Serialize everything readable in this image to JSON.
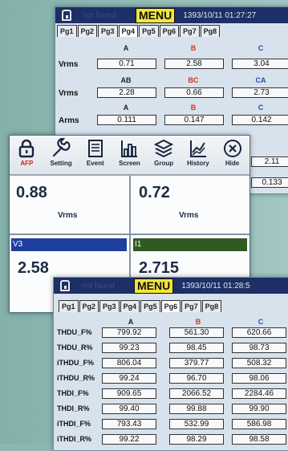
{
  "top_screen": {
    "status_text": "not found",
    "menu_label": "MENU",
    "datetime": "1393/10/11 01:27:27",
    "tabs": [
      "Pg1",
      "Pg2",
      "Pg3",
      "Pg4",
      "Pg5",
      "Pg6",
      "Pg7",
      "Pg8"
    ],
    "active_tab": "Pg4",
    "rows": [
      {
        "label": "Vrms",
        "heads": [
          "A",
          "B",
          "C"
        ],
        "values": [
          "0.71",
          "2.58",
          "3.04"
        ]
      },
      {
        "label": "Vrms",
        "heads": [
          "AB",
          "BC",
          "CA"
        ],
        "values": [
          "2.28",
          "0.66",
          "2.73"
        ]
      },
      {
        "label": "Arms",
        "heads": [
          "A",
          "B",
          "C"
        ],
        "values": [
          "0.111",
          "0.147",
          "0.142"
        ]
      }
    ],
    "partial_values": [
      "2.11",
      "0.133"
    ]
  },
  "dashboard": {
    "toolbar": [
      {
        "label": "AFP",
        "icon": "lock-icon"
      },
      {
        "label": "Setting",
        "icon": "wrench-icon"
      },
      {
        "label": "Event",
        "icon": "document-icon"
      },
      {
        "label": "Screen",
        "icon": "bar-chart-icon"
      },
      {
        "label": "Group",
        "icon": "layers-icon"
      },
      {
        "label": "History",
        "icon": "history-chart-icon"
      },
      {
        "label": "Hide",
        "icon": "close-circle-icon"
      }
    ],
    "panels": [
      {
        "value": "0.88",
        "unit": "Vrms"
      },
      {
        "value": "0.72",
        "unit": "Vrms"
      },
      {
        "channel": "V3",
        "value": "2.58"
      },
      {
        "channel": "I1",
        "value": "2.715"
      }
    ],
    "colors": {
      "v3_bar": "#1f3f9e",
      "i1_bar": "#2f5a22"
    }
  },
  "bottom_screen": {
    "status_text": "not found",
    "menu_label": "MENU",
    "datetime": "1393/10/11 01:28:5",
    "tabs": [
      "Pg1",
      "Pg2",
      "Pg3",
      "Pg4",
      "Pg5",
      "Pg6",
      "Pg7",
      "Pg8"
    ],
    "active_tab": "Pg6",
    "heads": [
      "A",
      "B",
      "C"
    ],
    "rows": [
      {
        "label": "THDU_F%",
        "values": [
          "799.92",
          "561.30",
          "620.66"
        ]
      },
      {
        "label": "THDU_R%",
        "values": [
          "99.23",
          "98.45",
          "98.73"
        ]
      },
      {
        "label": "iTHDU_F%",
        "values": [
          "806.04",
          "379.77",
          "508.32"
        ]
      },
      {
        "label": "iTHDU_R%",
        "values": [
          "99.24",
          "96.70",
          "98.06"
        ]
      },
      {
        "label": "THDI_F%",
        "values": [
          "909.65",
          "2066.52",
          "2284.46"
        ]
      },
      {
        "label": "THDI_R%",
        "values": [
          "99.40",
          "99.88",
          "99.90"
        ]
      },
      {
        "label": "iTHDI_F%",
        "values": [
          "793.43",
          "532.99",
          "586.98"
        ]
      },
      {
        "label": "iTHDI_R%",
        "values": [
          "99.22",
          "98.29",
          "98.58"
        ]
      }
    ]
  }
}
